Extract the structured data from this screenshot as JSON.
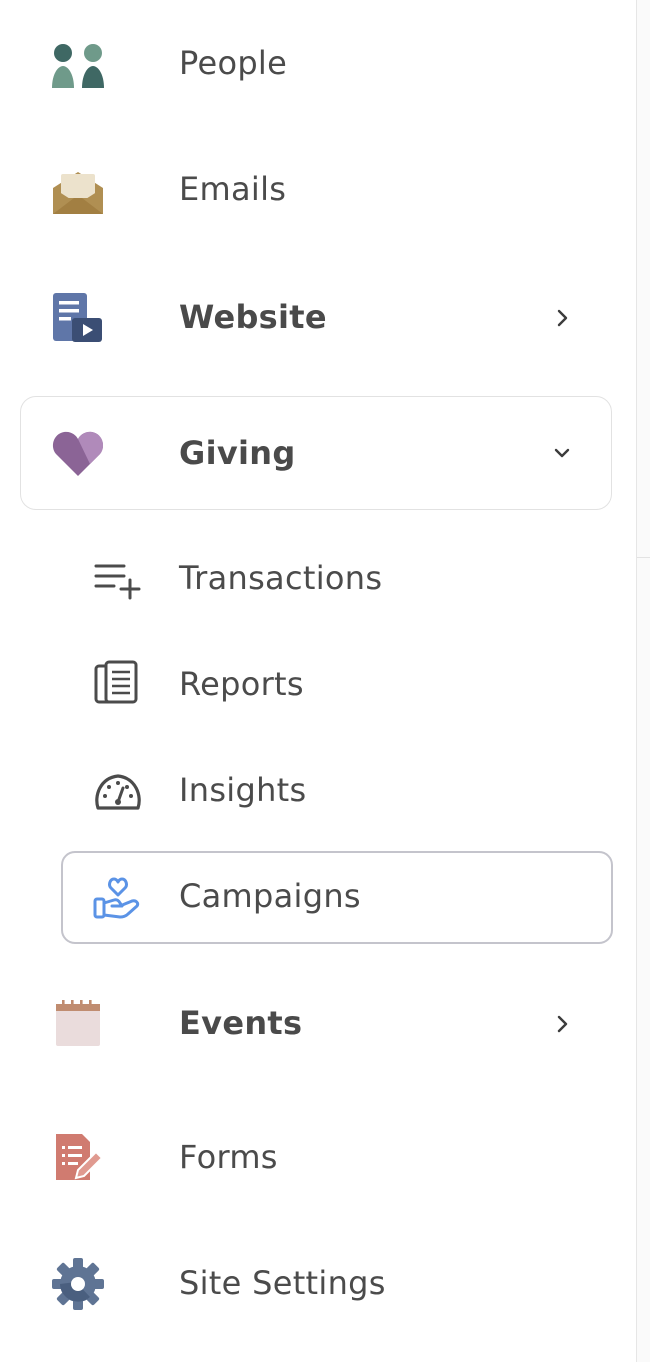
{
  "nav": {
    "people": {
      "label": "People",
      "icon": "people-icon"
    },
    "emails": {
      "label": "Emails",
      "icon": "envelope-icon"
    },
    "website": {
      "label": "Website",
      "icon": "website-icon"
    },
    "giving": {
      "label": "Giving",
      "icon": "heart-icon",
      "expanded": true,
      "children": {
        "transactions": {
          "label": "Transactions",
          "icon": "list-add-icon"
        },
        "reports": {
          "label": "Reports",
          "icon": "reports-icon"
        },
        "insights": {
          "label": "Insights",
          "icon": "gauge-icon"
        },
        "campaigns": {
          "label": "Campaigns",
          "icon": "hand-heart-icon",
          "selected": true
        }
      }
    },
    "events": {
      "label": "Events",
      "icon": "calendar-icon"
    },
    "forms": {
      "label": "Forms",
      "icon": "form-edit-icon"
    },
    "site_settings": {
      "label": "Site Settings",
      "icon": "gear-icon"
    }
  },
  "colors": {
    "people_dark": "#3f6864",
    "people_light": "#6f9a8a",
    "email_body": "#b08f52",
    "email_paper": "#ece2cc",
    "website_doc": "#5f76a8",
    "website_play": "#3b4e74",
    "giving_heart": "#8b6496",
    "campaign_icon": "#5b93e6",
    "events_top": "#c08c70",
    "events_body": "#eadcdc",
    "forms": "#d07b70",
    "gear": "#5f7494",
    "text": "#4b4b4b"
  }
}
